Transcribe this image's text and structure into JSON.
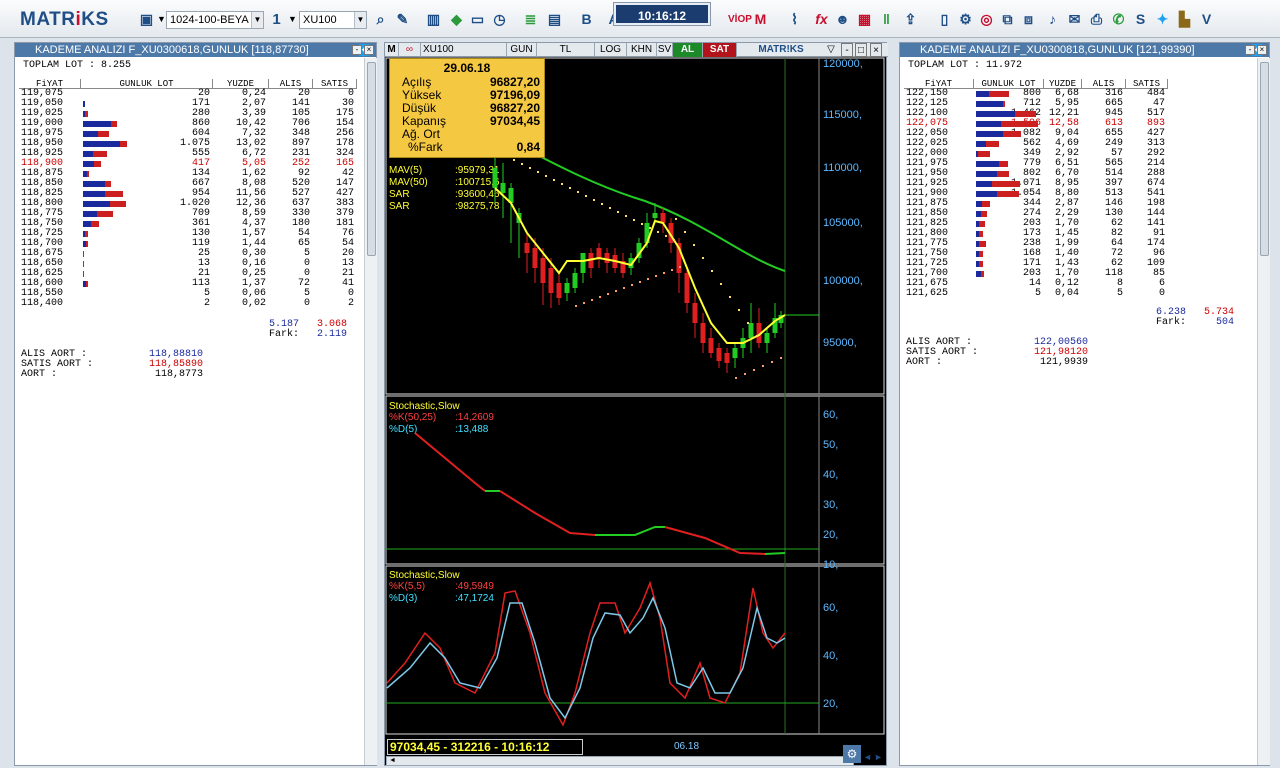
{
  "toolbar": {
    "logo_left": "MATR",
    "logo_mid": "i",
    "logo_right": "KS",
    "template": "1024-100-BEYA",
    "page_no": "1",
    "symbol": "XU100",
    "clock": "10:16:12"
  },
  "left": {
    "title": "KADEME ANALIZI F_XU0300618,GUNLUK [118,87730]",
    "total_lot_label": "TOPLAM LOT :",
    "total_lot": "8.255",
    "headers": [
      "FiYAT",
      "GUNLUK LOT",
      "YUZDE",
      "ALIS",
      "SATIS"
    ],
    "rows": [
      {
        "price": "119,075",
        "lot": "20",
        "pct": "0,24",
        "buy": "20",
        "sell": "0",
        "bb": 0,
        "br": 0
      },
      {
        "price": "119,050",
        "lot": "171",
        "pct": "2,07",
        "buy": "141",
        "sell": "30",
        "bb": 2,
        "br": 0
      },
      {
        "price": "119,025",
        "lot": "280",
        "pct": "3,39",
        "buy": "105",
        "sell": "175",
        "bb": 2,
        "br": 3
      },
      {
        "price": "119,000",
        "lot": "860",
        "pct": "10,42",
        "buy": "706",
        "sell": "154",
        "bb": 28,
        "br": 6
      },
      {
        "price": "118,975",
        "lot": "604",
        "pct": "7,32",
        "buy": "348",
        "sell": "256",
        "bb": 15,
        "br": 11
      },
      {
        "price": "118,950",
        "lot": "1.075",
        "pct": "13,02",
        "buy": "897",
        "sell": "178",
        "bb": 37,
        "br": 7
      },
      {
        "price": "118,925",
        "lot": "555",
        "pct": "6,72",
        "buy": "231",
        "sell": "324",
        "bb": 10,
        "br": 14
      },
      {
        "price": "118,900",
        "lot": "417",
        "pct": "5,05",
        "buy": "252",
        "sell": "165",
        "bb": 11,
        "br": 7,
        "hl": true
      },
      {
        "price": "118,875",
        "lot": "134",
        "pct": "1,62",
        "buy": "92",
        "sell": "42",
        "bb": 4,
        "br": 2
      },
      {
        "price": "118,850",
        "lot": "667",
        "pct": "8,08",
        "buy": "520",
        "sell": "147",
        "bb": 22,
        "br": 6
      },
      {
        "price": "118,825",
        "lot": "954",
        "pct": "11,56",
        "buy": "527",
        "sell": "427",
        "bb": 22,
        "br": 18
      },
      {
        "price": "118,800",
        "lot": "1.020",
        "pct": "12,36",
        "buy": "637",
        "sell": "383",
        "bb": 27,
        "br": 16
      },
      {
        "price": "118,775",
        "lot": "709",
        "pct": "8,59",
        "buy": "330",
        "sell": "379",
        "bb": 14,
        "br": 16
      },
      {
        "price": "118,750",
        "lot": "361",
        "pct": "4,37",
        "buy": "180",
        "sell": "181",
        "bb": 8,
        "br": 8
      },
      {
        "price": "118,725",
        "lot": "130",
        "pct": "1,57",
        "buy": "54",
        "sell": "76",
        "bb": 2,
        "br": 3
      },
      {
        "price": "118,700",
        "lot": "119",
        "pct": "1,44",
        "buy": "65",
        "sell": "54",
        "bb": 3,
        "br": 2
      },
      {
        "price": "118,675",
        "lot": "25",
        "pct": "0,30",
        "buy": "5",
        "sell": "20",
        "bb": 0,
        "br": 1
      },
      {
        "price": "118,650",
        "lot": "13",
        "pct": "0,16",
        "buy": "0",
        "sell": "13",
        "bb": 0,
        "br": 1
      },
      {
        "price": "118,625",
        "lot": "21",
        "pct": "0,25",
        "buy": "0",
        "sell": "21",
        "bb": 0,
        "br": 1
      },
      {
        "price": "118,600",
        "lot": "113",
        "pct": "1,37",
        "buy": "72",
        "sell": "41",
        "bb": 3,
        "br": 2
      },
      {
        "price": "118,550",
        "lot": "5",
        "pct": "0,06",
        "buy": "5",
        "sell": "0",
        "bb": 0,
        "br": 0
      },
      {
        "price": "118,400",
        "lot": "2",
        "pct": "0,02",
        "buy": "0",
        "sell": "2",
        "bb": 0,
        "br": 0
      }
    ],
    "sum_buy": "5.187",
    "sum_sell": "3.068",
    "fark_label": "Fark:",
    "fark": "2.119",
    "alis_aort_label": "ALIS AORT  :",
    "alis_aort": "118,88810",
    "satis_aort_label": "SATIS AORT :",
    "satis_aort": "118,85890",
    "aort_label": "AORT  :",
    "aort": "118,8773"
  },
  "right": {
    "title": "KADEME ANALIZI F_XU0300818,GUNLUK [121,99390]",
    "total_lot_label": "TOPLAM LOT :",
    "total_lot": "11.972",
    "headers": [
      "FiYAT",
      "GUNLUK LOT",
      "YUZDE",
      "ALIS",
      "SATIS"
    ],
    "rows": [
      {
        "price": "122,150",
        "lot": "800",
        "pct": "6,68",
        "buy": "316",
        "sell": "484",
        "bb": 13,
        "br": 20
      },
      {
        "price": "122,125",
        "lot": "712",
        "pct": "5,95",
        "buy": "665",
        "sell": "47",
        "bb": 27,
        "br": 2
      },
      {
        "price": "122,100",
        "lot": "1.462",
        "pct": "12,21",
        "buy": "945",
        "sell": "517",
        "bb": 39,
        "br": 21
      },
      {
        "price": "122,075",
        "lot": "1.506",
        "pct": "12,58",
        "buy": "613",
        "sell": "893",
        "bb": 25,
        "br": 37,
        "hl": true
      },
      {
        "price": "122,050",
        "lot": "1.082",
        "pct": "9,04",
        "buy": "655",
        "sell": "427",
        "bb": 27,
        "br": 18
      },
      {
        "price": "122,025",
        "lot": "562",
        "pct": "4,69",
        "buy": "249",
        "sell": "313",
        "bb": 10,
        "br": 13
      },
      {
        "price": "122,000",
        "lot": "349",
        "pct": "2,92",
        "buy": "57",
        "sell": "292",
        "bb": 2,
        "br": 12
      },
      {
        "price": "121,975",
        "lot": "779",
        "pct": "6,51",
        "buy": "565",
        "sell": "214",
        "bb": 23,
        "br": 9
      },
      {
        "price": "121,950",
        "lot": "802",
        "pct": "6,70",
        "buy": "514",
        "sell": "288",
        "bb": 21,
        "br": 12
      },
      {
        "price": "121,925",
        "lot": "1.071",
        "pct": "8,95",
        "buy": "397",
        "sell": "674",
        "bb": 16,
        "br": 28
      },
      {
        "price": "121,900",
        "lot": "1.054",
        "pct": "8,80",
        "buy": "513",
        "sell": "541",
        "bb": 21,
        "br": 22
      },
      {
        "price": "121,875",
        "lot": "344",
        "pct": "2,87",
        "buy": "146",
        "sell": "198",
        "bb": 6,
        "br": 8
      },
      {
        "price": "121,850",
        "lot": "274",
        "pct": "2,29",
        "buy": "130",
        "sell": "144",
        "bb": 5,
        "br": 6
      },
      {
        "price": "121,825",
        "lot": "203",
        "pct": "1,70",
        "buy": "62",
        "sell": "141",
        "bb": 3,
        "br": 6
      },
      {
        "price": "121,800",
        "lot": "173",
        "pct": "1,45",
        "buy": "82",
        "sell": "91",
        "bb": 3,
        "br": 4
      },
      {
        "price": "121,775",
        "lot": "238",
        "pct": "1,99",
        "buy": "64",
        "sell": "174",
        "bb": 3,
        "br": 7
      },
      {
        "price": "121,750",
        "lot": "168",
        "pct": "1,40",
        "buy": "72",
        "sell": "96",
        "bb": 3,
        "br": 4
      },
      {
        "price": "121,725",
        "lot": "171",
        "pct": "1,43",
        "buy": "62",
        "sell": "109",
        "bb": 3,
        "br": 4
      },
      {
        "price": "121,700",
        "lot": "203",
        "pct": "1,70",
        "buy": "118",
        "sell": "85",
        "bb": 5,
        "br": 3
      },
      {
        "price": "121,675",
        "lot": "14",
        "pct": "0,12",
        "buy": "8",
        "sell": "6",
        "bb": 0,
        "br": 0
      },
      {
        "price": "121,625",
        "lot": "5",
        "pct": "0,04",
        "buy": "5",
        "sell": "0",
        "bb": 0,
        "br": 0
      }
    ],
    "sum_buy": "6.238",
    "sum_sell": "5.734",
    "fark_label": "Fark:",
    "fark": "504",
    "alis_aort_label": "ALIS AORT  :",
    "alis_aort": "122,00560",
    "satis_aort_label": "SATIS AORT :",
    "satis_aort": "121,98120",
    "aort_label": "AORT  :",
    "aort": "121,9939"
  },
  "chart": {
    "symbol": "XU100",
    "tabs": [
      "GUN",
      "TL",
      "LOG",
      "KHN",
      "SV"
    ],
    "al": "AL",
    "sat": "SAT",
    "brand": "MATR!KS",
    "info": {
      "date": "29.06.18",
      "rows": [
        {
          "label": "Açılış",
          "value": "96827,20"
        },
        {
          "label": "Yüksek",
          "value": "97196,09"
        },
        {
          "label": "Düşük",
          "value": "96827,20"
        },
        {
          "label": "Kapanış",
          "value": "97034,45"
        },
        {
          "label": "Ağ. Ort",
          "value": ""
        },
        {
          "label": "%Fark",
          "value": "0,84"
        }
      ]
    },
    "legend": [
      {
        "label": "MAV(5)",
        "value": ":95979,31"
      },
      {
        "label": "MAV(50)",
        "value": ":100715,6"
      },
      {
        "label": "SAR",
        "value": ":93600,46"
      },
      {
        "label": "SAR",
        "value": ":98275,78"
      }
    ],
    "price_axis": [
      "120000,",
      "115000,",
      "110000,",
      "105000,",
      "100000,",
      "95000,"
    ],
    "stoch1": {
      "title": "Stochastic,Slow",
      "k_label": "%K(50,25)",
      "k_value": ":14,2609",
      "d_label": "%D(5)",
      "d_value": ":13,488",
      "axis": [
        "60,",
        "50,",
        "40,",
        "30,",
        "20,",
        "10,"
      ]
    },
    "stoch2": {
      "title": "Stochastic,Slow",
      "k_label": "%K(5,5)",
      "k_value": ":49,5949",
      "d_label": "%D(3)",
      "d_value": ":47,1724",
      "axis": [
        "60,",
        "40,",
        "20,"
      ]
    },
    "status_text": "97034,45 - 312216 - 10:16:12",
    "date_label": "06.18"
  },
  "colors": {
    "title_bar": "#4d79a8",
    "accent": "#1f4e86",
    "buy": "#1a2a9c",
    "sell": "#cc2020",
    "chart_bg": "#000000",
    "yellow": "#ffff33",
    "green": "#22cc22"
  }
}
